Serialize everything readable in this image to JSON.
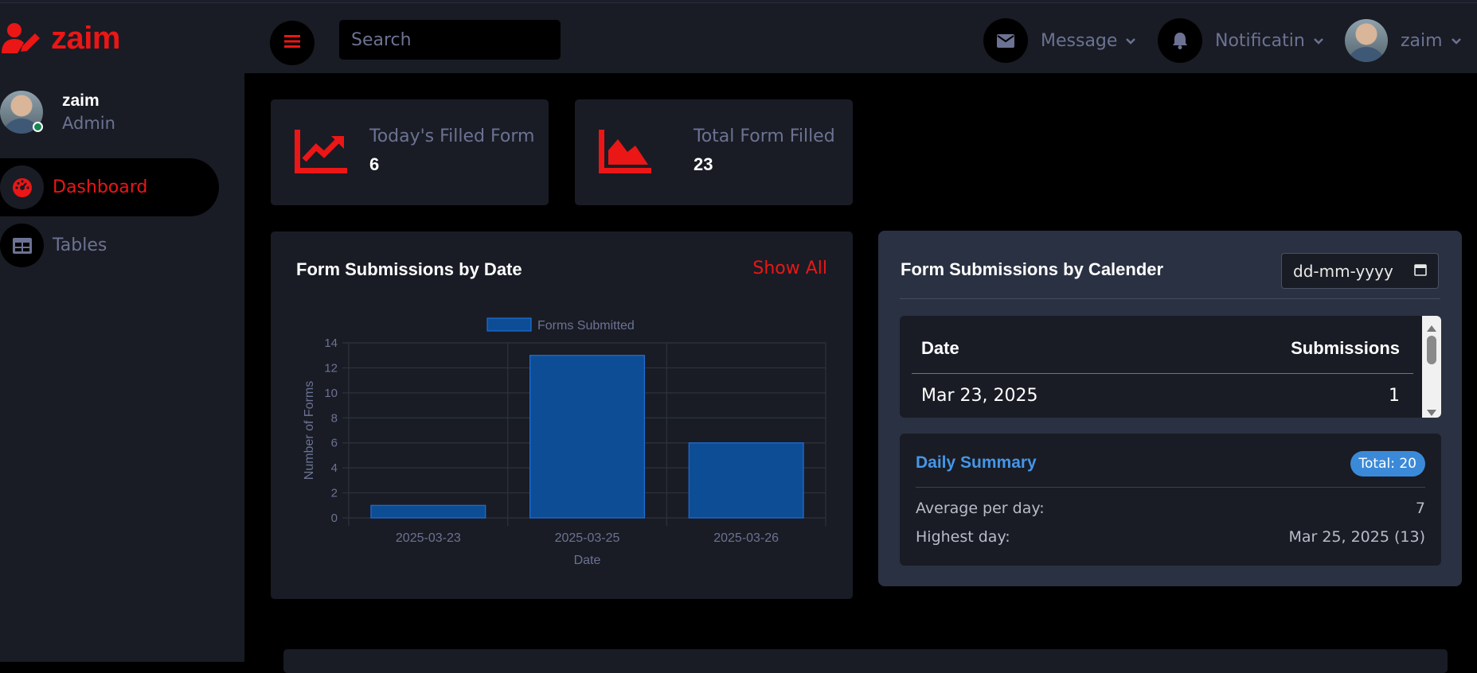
{
  "brand": {
    "name": "zaim"
  },
  "sidebar": {
    "profile": {
      "name": "zaim",
      "role": "Admin"
    },
    "items": [
      {
        "label": "Dashboard",
        "icon": "tachometer-icon",
        "active": true
      },
      {
        "label": "Tables",
        "icon": "table-icon",
        "active": false
      }
    ]
  },
  "header": {
    "search_placeholder": "Search",
    "message_label": "Message",
    "notification_label": "Notificatin",
    "user_label": "zaim"
  },
  "stats": [
    {
      "label": "Today's Filled Form",
      "value": "6",
      "icon": "chart-line-icon"
    },
    {
      "label": "Total Form Filled",
      "value": "23",
      "icon": "chart-area-icon"
    }
  ],
  "chart_card": {
    "title": "Form Submissions by Date",
    "show_all": "Show All"
  },
  "chart_data": {
    "type": "bar",
    "categories": [
      "2025-03-23",
      "2025-03-25",
      "2025-03-26"
    ],
    "series": [
      {
        "name": "Forms Submitted",
        "values": [
          1,
          13,
          6
        ]
      }
    ],
    "xlabel": "Date",
    "ylabel": "Number of Forms",
    "ylim": [
      0,
      14
    ],
    "yticks": [
      "0",
      "2",
      "4",
      "6",
      "8",
      "10",
      "12",
      "14"
    ],
    "grid": true,
    "legend": "top",
    "bar_color": "#0d4d96",
    "bar_border": "#1e6fd9"
  },
  "calendar_card": {
    "title": "Form Submissions by Calender",
    "date_placeholder": "dd-mm-yyyy",
    "table": {
      "headers": [
        "Date",
        "Submissions"
      ],
      "rows": [
        {
          "date": "Mar 23, 2025",
          "count": "1"
        }
      ]
    },
    "summary": {
      "title": "Daily Summary",
      "badge": "Total: 20",
      "avg_label": "Average per day:",
      "avg_value": "7",
      "high_label": "Highest day:",
      "high_value": "Mar 25, 2025 (13)"
    }
  },
  "colors": {
    "accent": "#eb1616",
    "panel": "#191c24",
    "muted": "#6c7293",
    "calendar_panel": "#2a3142",
    "summary_blue": "#4596e8"
  }
}
